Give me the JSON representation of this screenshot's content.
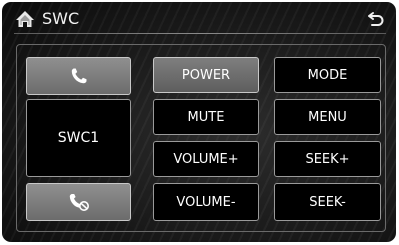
{
  "header": {
    "title": "SWC",
    "home_icon": "home-icon",
    "back_icon": "back-arrow-icon"
  },
  "left_column": {
    "call_icon": "phone-icon",
    "swc_label": "SWC1",
    "hangup_icon": "phone-hangup-icon"
  },
  "controls": {
    "power": "POWER",
    "mode": "MODE",
    "mute": "MUTE",
    "menu": "MENU",
    "volume_up": "VOLUME+",
    "seek_up": "SEEK+",
    "volume_down": "VOLUME-",
    "seek_down": "SEEK-"
  },
  "colors": {
    "background": "#141414",
    "button_fill": "#000000",
    "button_border": "#9a9a9a",
    "highlight_button": "#707070",
    "text": "#ffffff"
  }
}
